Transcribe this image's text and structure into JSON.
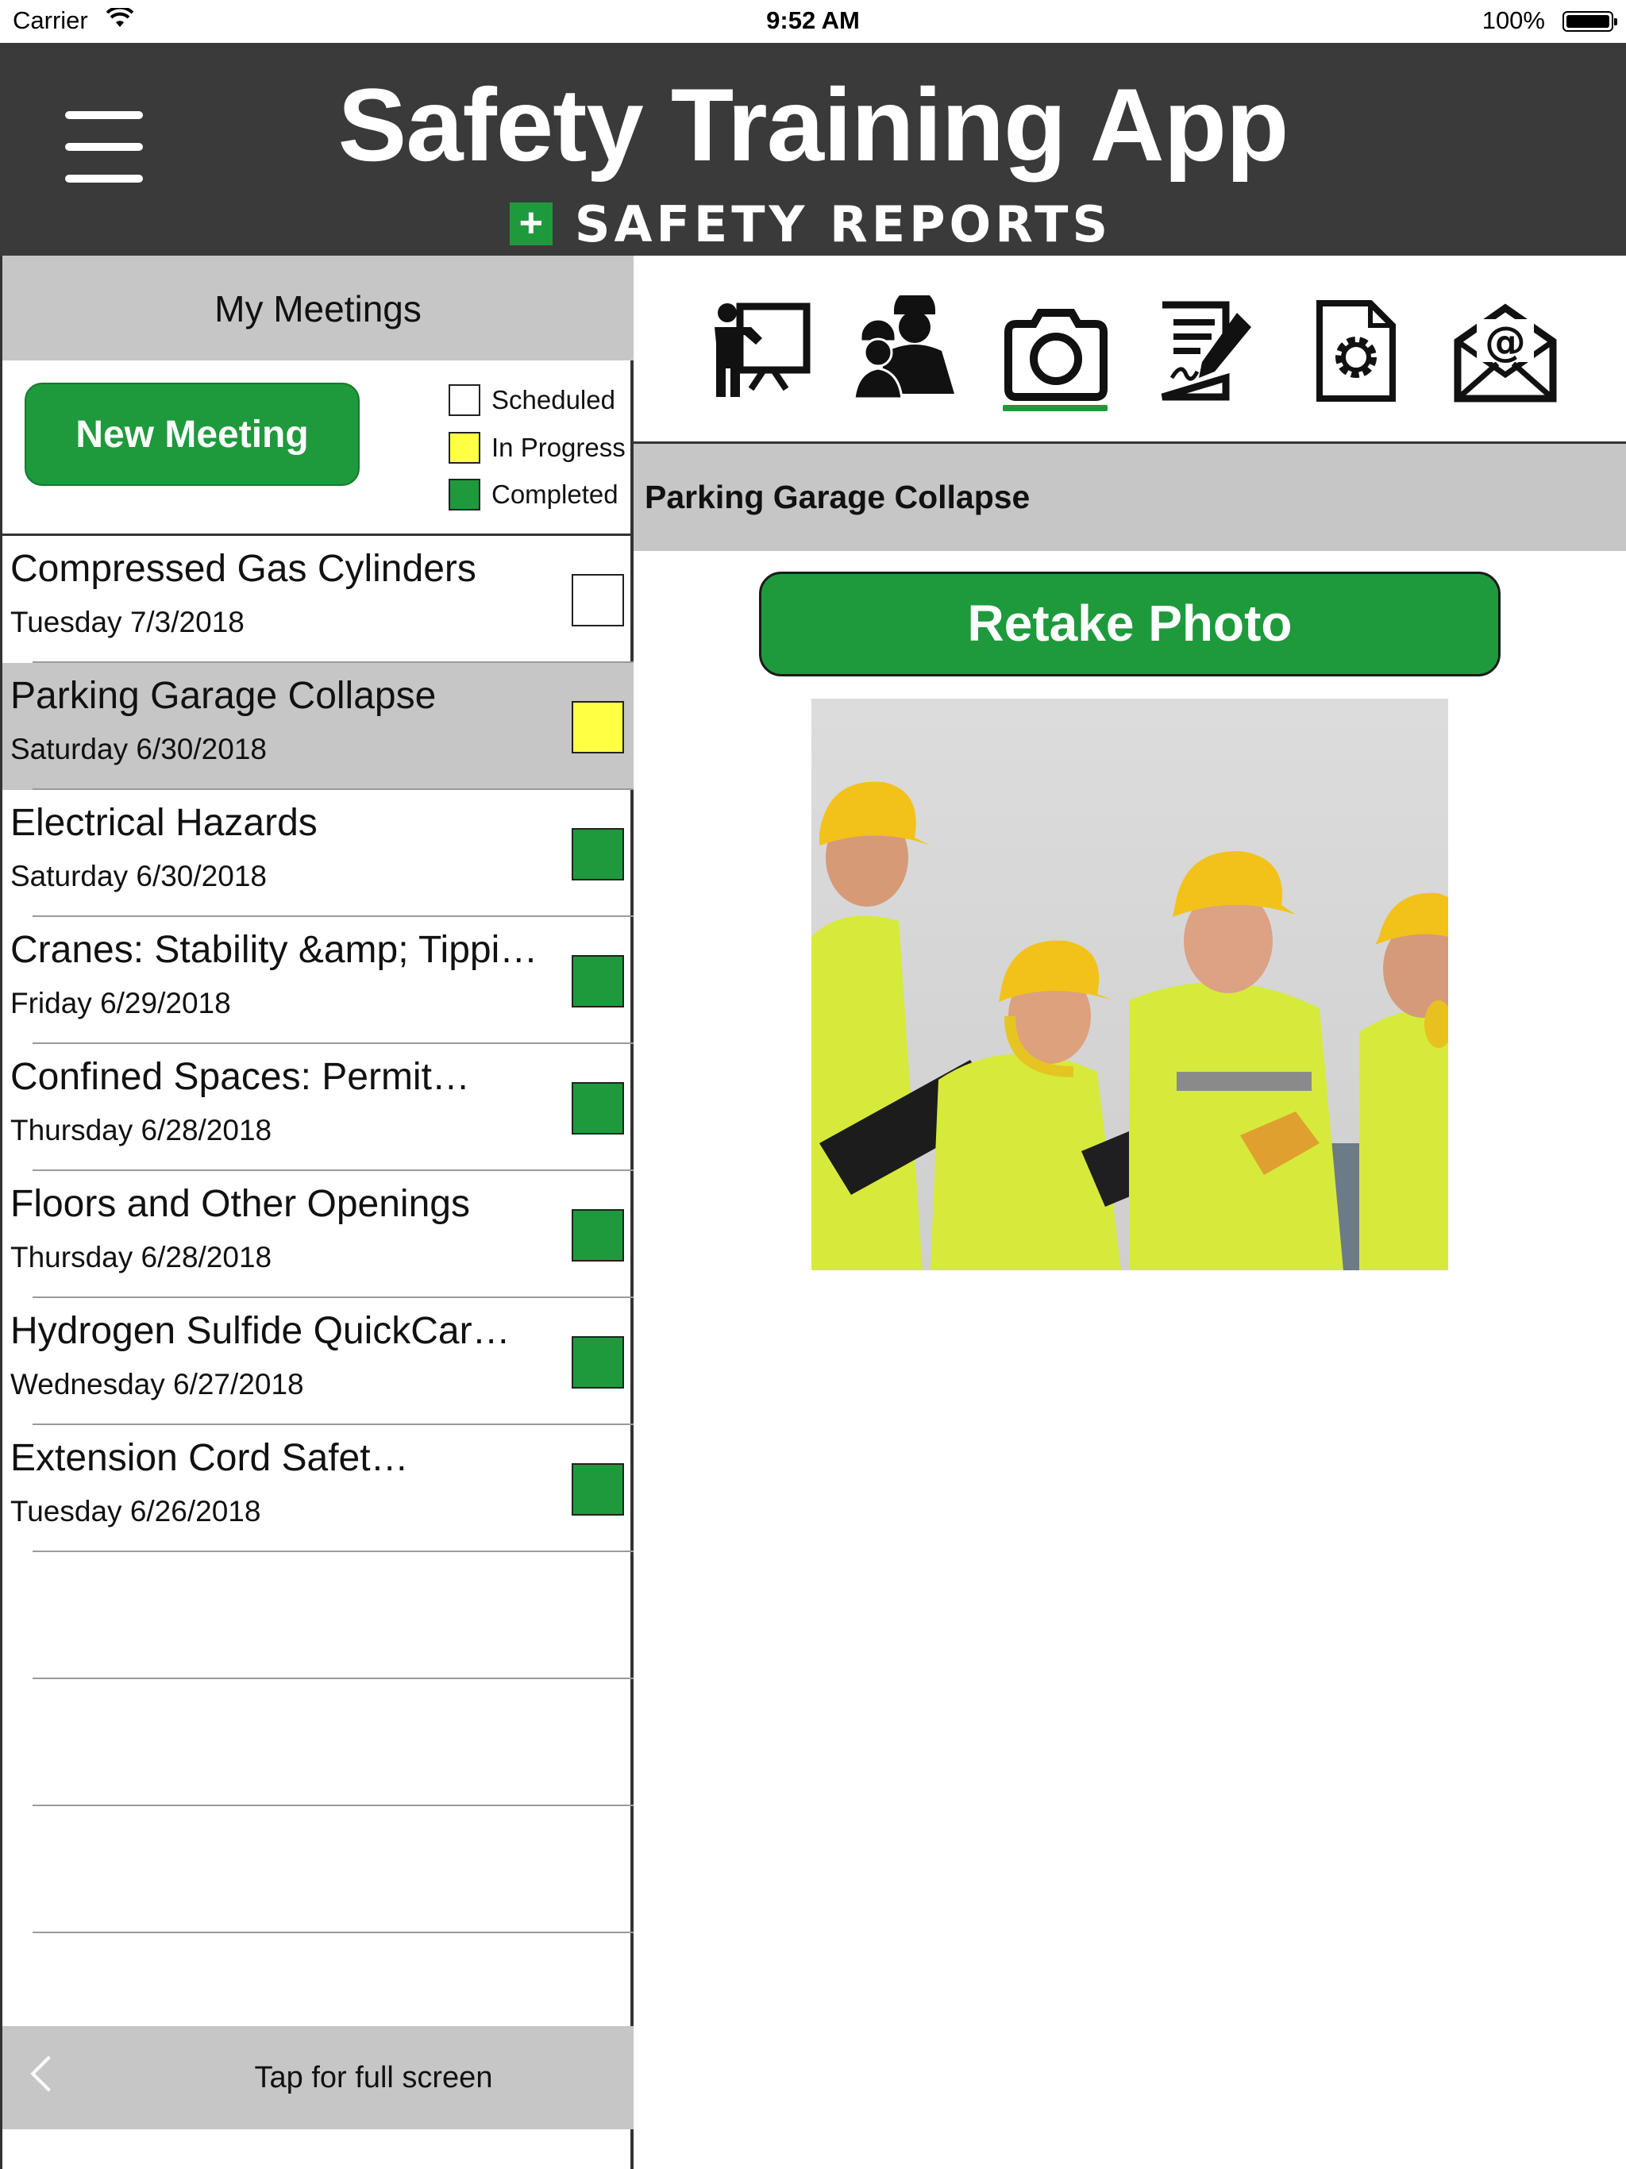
{
  "status_bar": {
    "carrier": "Carrier",
    "time": "9:52 AM",
    "battery": "100%",
    "battery_level": 1.0
  },
  "header": {
    "title": "Safety Training App",
    "brand": "SAFETY REPORTS"
  },
  "meetings_panel": {
    "title": "My Meetings",
    "new_meeting_label": "New Meeting",
    "legend": [
      {
        "label": "Scheduled",
        "color": "#ffffff"
      },
      {
        "label": "In Progress",
        "color": "#ffff44"
      },
      {
        "label": "Completed",
        "color": "#1e9a3c"
      }
    ],
    "meetings": [
      {
        "title": "Compressed Gas Cylinders",
        "date": "Tuesday 7/3/2018",
        "status": "scheduled"
      },
      {
        "title": "Parking Garage Collapse",
        "date": "Saturday 6/30/2018",
        "status": "in_progress",
        "selected": true
      },
      {
        "title": "Electrical Hazards",
        "date": "Saturday 6/30/2018",
        "status": "completed"
      },
      {
        "title": "Cranes: Stability &amp; Tippi…",
        "date": "Friday 6/29/2018",
        "status": "completed"
      },
      {
        "title": "Confined Spaces: Permit…",
        "date": "Thursday 6/28/2018",
        "status": "completed"
      },
      {
        "title": "Floors and Other Openings",
        "date": "Thursday 6/28/2018",
        "status": "completed"
      },
      {
        "title": "Hydrogen Sulfide QuickCar…",
        "date": "Wednesday 6/27/2018",
        "status": "completed"
      },
      {
        "title": "Extension Cord Safet…",
        "date": "Tuesday 6/26/2018",
        "status": "completed"
      }
    ],
    "full_screen_label": "Tap for full screen"
  },
  "status_colors": {
    "scheduled": "#ffffff",
    "in_progress": "#ffff44",
    "completed": "#1e9a3c"
  },
  "toolbar": {
    "icons": [
      "presenter-icon",
      "workers-icon",
      "camera-icon",
      "sign-document-icon",
      "document-settings-icon",
      "email-icon"
    ],
    "active": "camera-icon"
  },
  "detail": {
    "meeting_name": "Parking Garage Collapse",
    "retake_label": "Retake Photo"
  }
}
